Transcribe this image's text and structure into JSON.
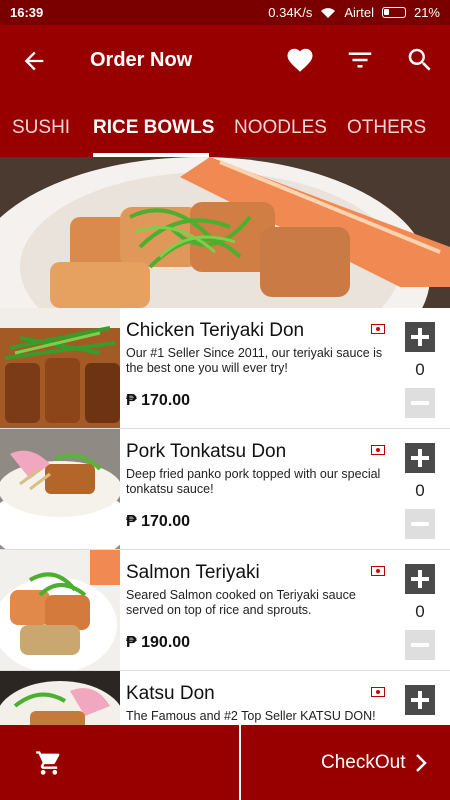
{
  "status": {
    "time": "16:39",
    "speed": "0.34K/s",
    "carrier": "Airtel",
    "battery": "21%"
  },
  "header": {
    "title": "Order Now",
    "icons": [
      "back-arrow-icon",
      "heart-icon",
      "filter-icon",
      "search-icon"
    ]
  },
  "tabs": [
    {
      "label": "SUSHI",
      "active": false
    },
    {
      "label": "RICE BOWLS",
      "active": true
    },
    {
      "label": "NOODLES",
      "active": false
    },
    {
      "label": "OTHERS",
      "active": false
    }
  ],
  "items": [
    {
      "name": "Chicken Teriyaki Don",
      "description": "Our #1 Seller Since 2011, our teriyaki sauce is the best one you will ever try!",
      "price": "₱ 170.00",
      "qty": "0"
    },
    {
      "name": "Pork Tonkatsu Don",
      "description": "Deep fried panko pork topped with our special tonkatsu sauce!",
      "price": "₱ 170.00",
      "qty": "0"
    },
    {
      "name": "Salmon Teriyaki",
      "description": "Seared Salmon cooked on Teriyaki sauce served on top of rice and sprouts.",
      "price": "₱ 190.00",
      "qty": "0"
    },
    {
      "name": "Katsu Don",
      "description": "The Famous and #2 Top Seller KATSU DON!",
      "price": "",
      "qty": ""
    }
  ],
  "footer": {
    "checkout_label": "CheckOut",
    "cart_icon": "cart-icon"
  },
  "colors": {
    "primary": "#980000",
    "status_bar": "#7a0000",
    "add_button": "#4a4a4a",
    "minus_button": "#dedede"
  }
}
